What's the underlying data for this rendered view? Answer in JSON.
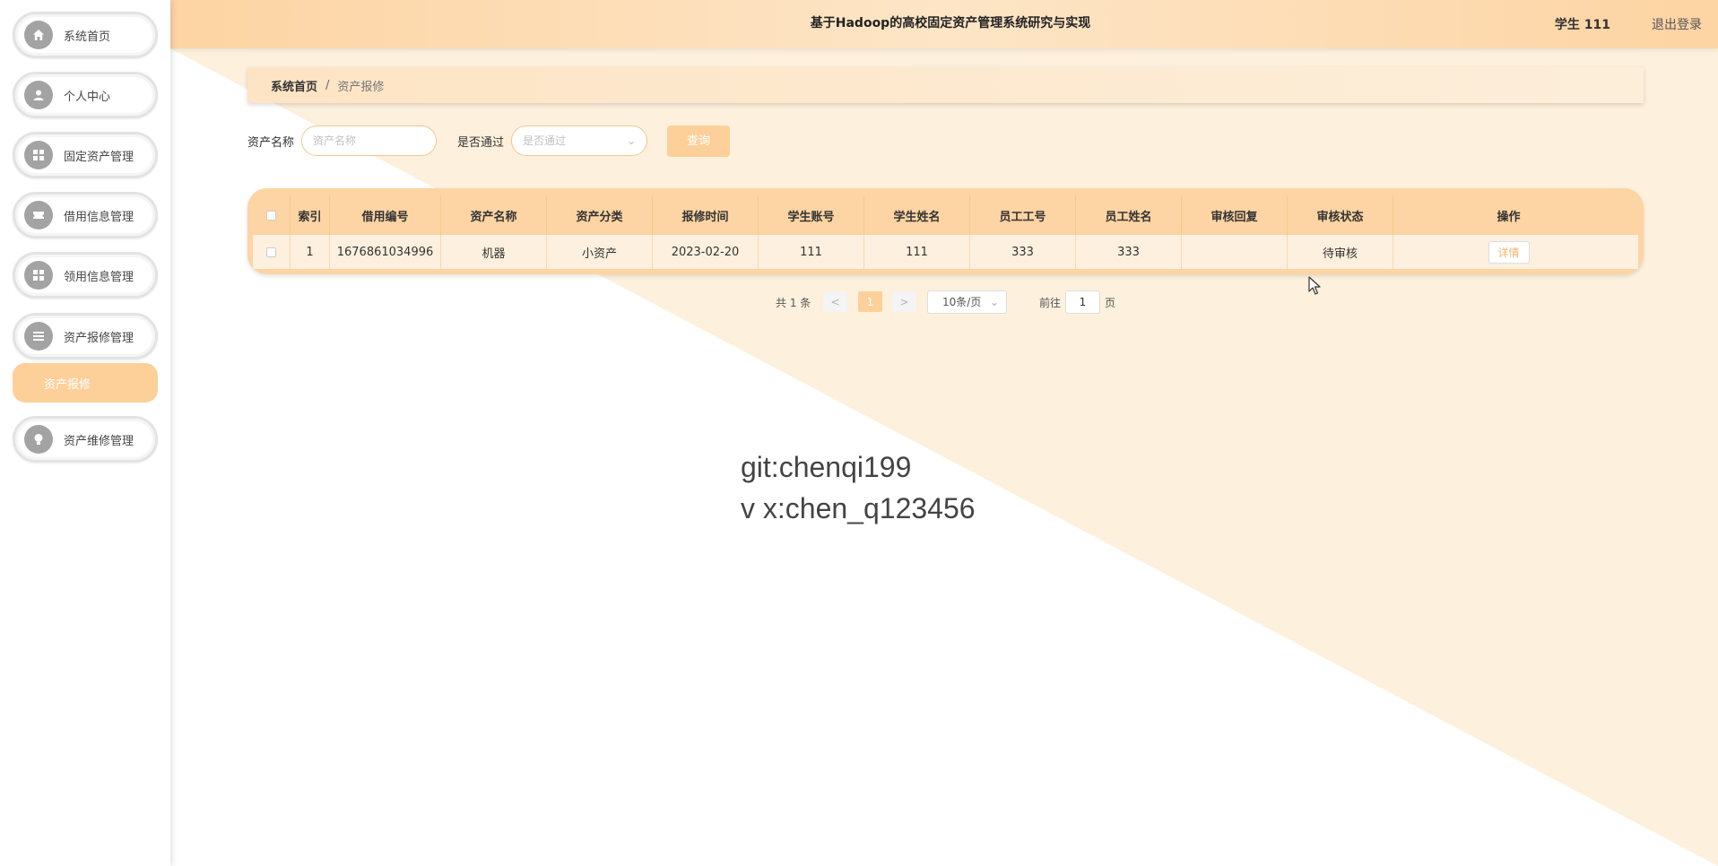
{
  "header": {
    "title": "基于Hadoop的高校固定资产管理系统研究与实现",
    "user": "学生 111",
    "logout": "退出登录"
  },
  "sidebar": {
    "items": [
      {
        "label": "系统首页",
        "icon": "home-icon"
      },
      {
        "label": "个人中心",
        "icon": "user-icon"
      },
      {
        "label": "固定资产管理",
        "icon": "grid-icon"
      },
      {
        "label": "借用信息管理",
        "icon": "ticket-icon"
      },
      {
        "label": "领用信息管理",
        "icon": "grid-icon"
      },
      {
        "label": "资产报修管理",
        "icon": "list-icon"
      },
      {
        "label": "资产维修管理",
        "icon": "bulb-icon"
      }
    ],
    "active_sub": "资产报修"
  },
  "breadcrumb": {
    "home": "系统首页",
    "sep": "/",
    "current": "资产报修"
  },
  "search": {
    "name_label": "资产名称",
    "name_placeholder": "资产名称",
    "pass_label": "是否通过",
    "pass_placeholder": "是否通过",
    "query_label": "查询"
  },
  "table": {
    "headers": [
      "索引",
      "借用编号",
      "资产名称",
      "资产分类",
      "报修时间",
      "学生账号",
      "学生姓名",
      "员工工号",
      "员工姓名",
      "审核回复",
      "审核状态",
      "操作"
    ],
    "rows": [
      {
        "index": "1",
        "borrow_no": "1676861034996",
        "asset_name": "机器",
        "category": "小资产",
        "repair_time": "2023-02-20",
        "student_account": "111",
        "student_name": "111",
        "staff_no": "333",
        "staff_name": "333",
        "reply": "",
        "status": "待审核",
        "action": "详情"
      }
    ]
  },
  "pagination": {
    "total": "共 1 条",
    "prev": "<",
    "current_page": "1",
    "next": ">",
    "page_size": "10条/页",
    "goto_label": "前往",
    "goto_value": "1",
    "page_suffix": "页"
  },
  "watermark": {
    "line1": "git:chenqi199",
    "line2": "v x:chen_q123456"
  },
  "colors": {
    "accent": "#fdd09a",
    "header_bg": "#fdd4a3",
    "background_tint": "#fdf0dc"
  }
}
